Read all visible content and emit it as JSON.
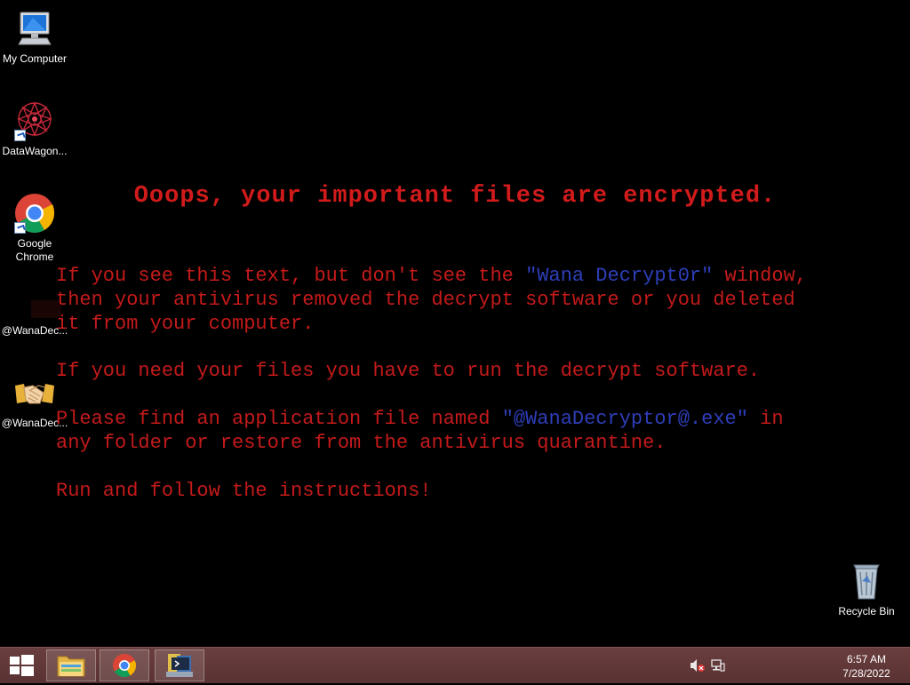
{
  "desktop": {
    "icons": [
      {
        "label": "My Computer",
        "icon": "computer-icon"
      },
      {
        "label": "DataWagon...",
        "icon": "datawagon-icon"
      },
      {
        "label": "Google Chrome",
        "icon": "chrome-icon"
      },
      {
        "label": "@WanaDec...",
        "icon": "wanadecryptor-icon"
      },
      {
        "label": "@WanaDec...",
        "icon": "handshake-icon"
      },
      {
        "label": "Recycle Bin",
        "icon": "recycle-bin-icon"
      }
    ]
  },
  "message": {
    "title": "Ooops, your important files are encrypted.",
    "p1_pre": "If you see this text, but don't see the ",
    "p1_hl": "\"Wana Decrypt0r\"",
    "p1_post": " window,\nthen your antivirus removed the decrypt software or you deleted\nit from your computer.",
    "p2": "If you need your files you have to run the decrypt software.",
    "p3_pre": "Please find an application file named ",
    "p3_hl": "\"@WanaDecryptor@.exe\"",
    "p3_post": " in\nany folder or restore from the antivirus quarantine.",
    "p4": "Run and follow the instructions!"
  },
  "taskbar": {
    "start": "windows-start-icon",
    "pinned": [
      "file-explorer-icon",
      "chrome-icon",
      "python-app-icon"
    ],
    "tray": {
      "volume": "volume-muted-icon",
      "network": "network-icon",
      "time": "6:57 AM",
      "date": "7/28/2022"
    }
  },
  "colors": {
    "message_red": "#c41a1a",
    "highlight_blue": "#2e3eb8",
    "taskbar": "#5f3738"
  }
}
